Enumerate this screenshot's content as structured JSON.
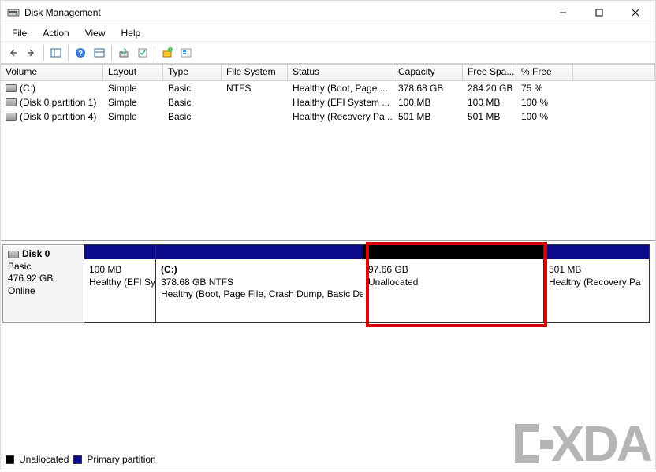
{
  "window": {
    "title": "Disk Management"
  },
  "menu": {
    "file": "File",
    "action": "Action",
    "view": "View",
    "help": "Help"
  },
  "columns": {
    "volume": "Volume",
    "layout": "Layout",
    "type": "Type",
    "filesystem": "File System",
    "status": "Status",
    "capacity": "Capacity",
    "freespace": "Free Spa...",
    "pctfree": "% Free"
  },
  "volumes": [
    {
      "name": "(C:)",
      "layout": "Simple",
      "type": "Basic",
      "fs": "NTFS",
      "status": "Healthy (Boot, Page ...",
      "capacity": "378.68 GB",
      "free": "284.20 GB",
      "pct": "75 %"
    },
    {
      "name": "(Disk 0 partition 1)",
      "layout": "Simple",
      "type": "Basic",
      "fs": "",
      "status": "Healthy (EFI System ...",
      "capacity": "100 MB",
      "free": "100 MB",
      "pct": "100 %"
    },
    {
      "name": "(Disk 0 partition 4)",
      "layout": "Simple",
      "type": "Basic",
      "fs": "",
      "status": "Healthy (Recovery Pa...",
      "capacity": "501 MB",
      "free": "501 MB",
      "pct": "100 %"
    }
  ],
  "disk": {
    "name": "Disk 0",
    "type": "Basic",
    "size": "476.92 GB",
    "state": "Online"
  },
  "parts": [
    {
      "label": "",
      "size": "100 MB",
      "status": "Healthy (EFI Sy",
      "bar": "primary"
    },
    {
      "label": "(C:)",
      "size": "378.68 GB NTFS",
      "status": "Healthy (Boot, Page File, Crash Dump, Basic Da",
      "bar": "primary"
    },
    {
      "label": "",
      "size": "97.66 GB",
      "status": "Unallocated",
      "bar": "unalloc"
    },
    {
      "label": "",
      "size": "501 MB",
      "status": "Healthy (Recovery Pa",
      "bar": "primary"
    }
  ],
  "legend": {
    "unallocated": "Unallocated",
    "primary": "Primary partition"
  },
  "colors": {
    "primary_bar": "#0a0a8a",
    "unallocated_bar": "#000000",
    "highlight": "#e00000"
  }
}
